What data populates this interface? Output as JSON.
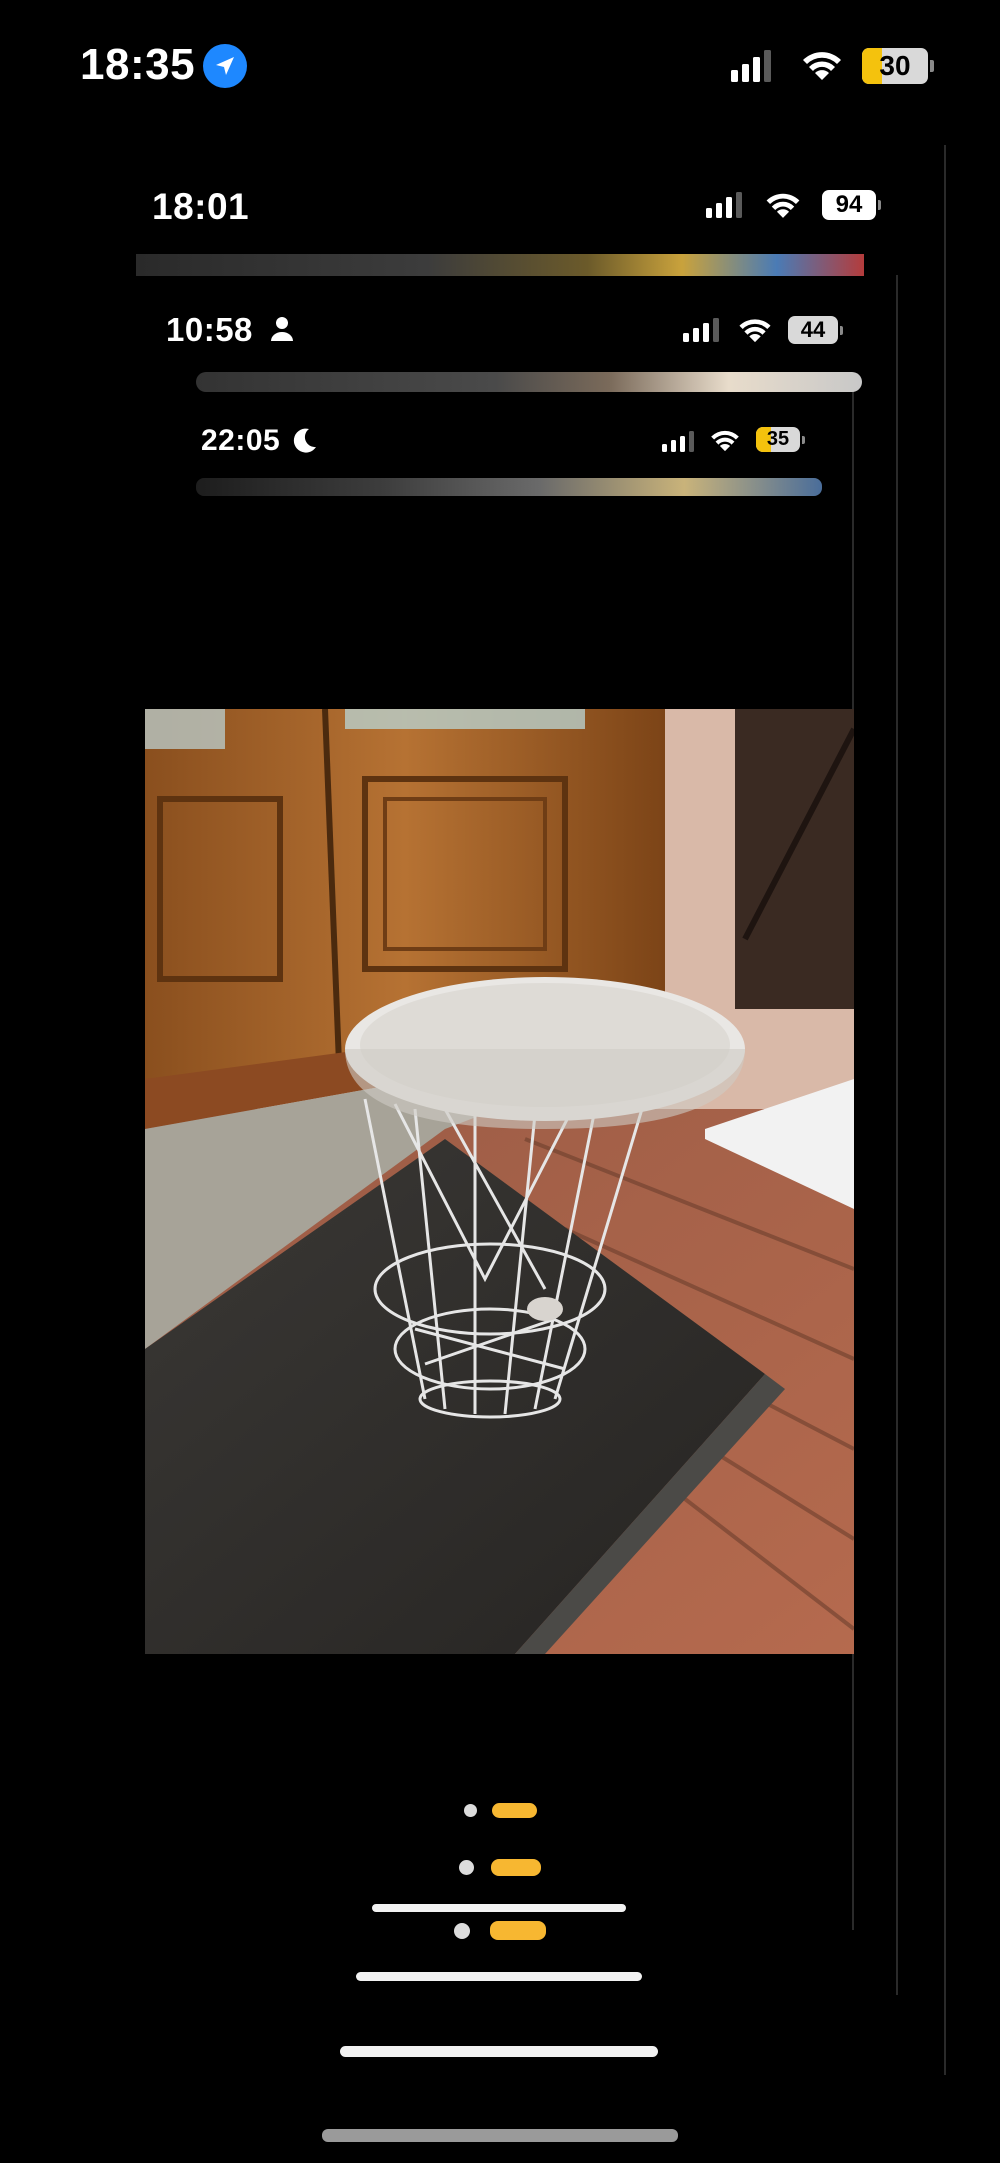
{
  "status_bars": [
    {
      "time": "18:35",
      "extra_icon": "location-arrow-icon",
      "battery": "30",
      "battery_color": "#f4c20d"
    },
    {
      "time": "18:01",
      "extra_icon": "",
      "battery": "94",
      "battery_color": "#ffffff"
    },
    {
      "time": "10:58",
      "extra_icon": "person-icon",
      "battery": "44",
      "battery_color": "#ffffff"
    },
    {
      "time": "22:05",
      "extra_icon": "moon-icon",
      "battery": "35",
      "battery_color": "#f4c20d"
    }
  ],
  "photo": {
    "subject": "white wire basket side table",
    "icon": "photo-image"
  },
  "page_indicators": [
    {
      "dot": "dot-icon",
      "pill": "active-page-pill",
      "color": "#f7b731"
    },
    {
      "dot": "dot-icon",
      "pill": "active-page-pill",
      "color": "#f7b731"
    },
    {
      "dot": "dot-icon",
      "pill": "active-page-pill",
      "color": "#f7b731"
    }
  ],
  "colors": {
    "background": "#000000",
    "accent": "#f7b731",
    "home_indicator": "#f2f2f2"
  }
}
